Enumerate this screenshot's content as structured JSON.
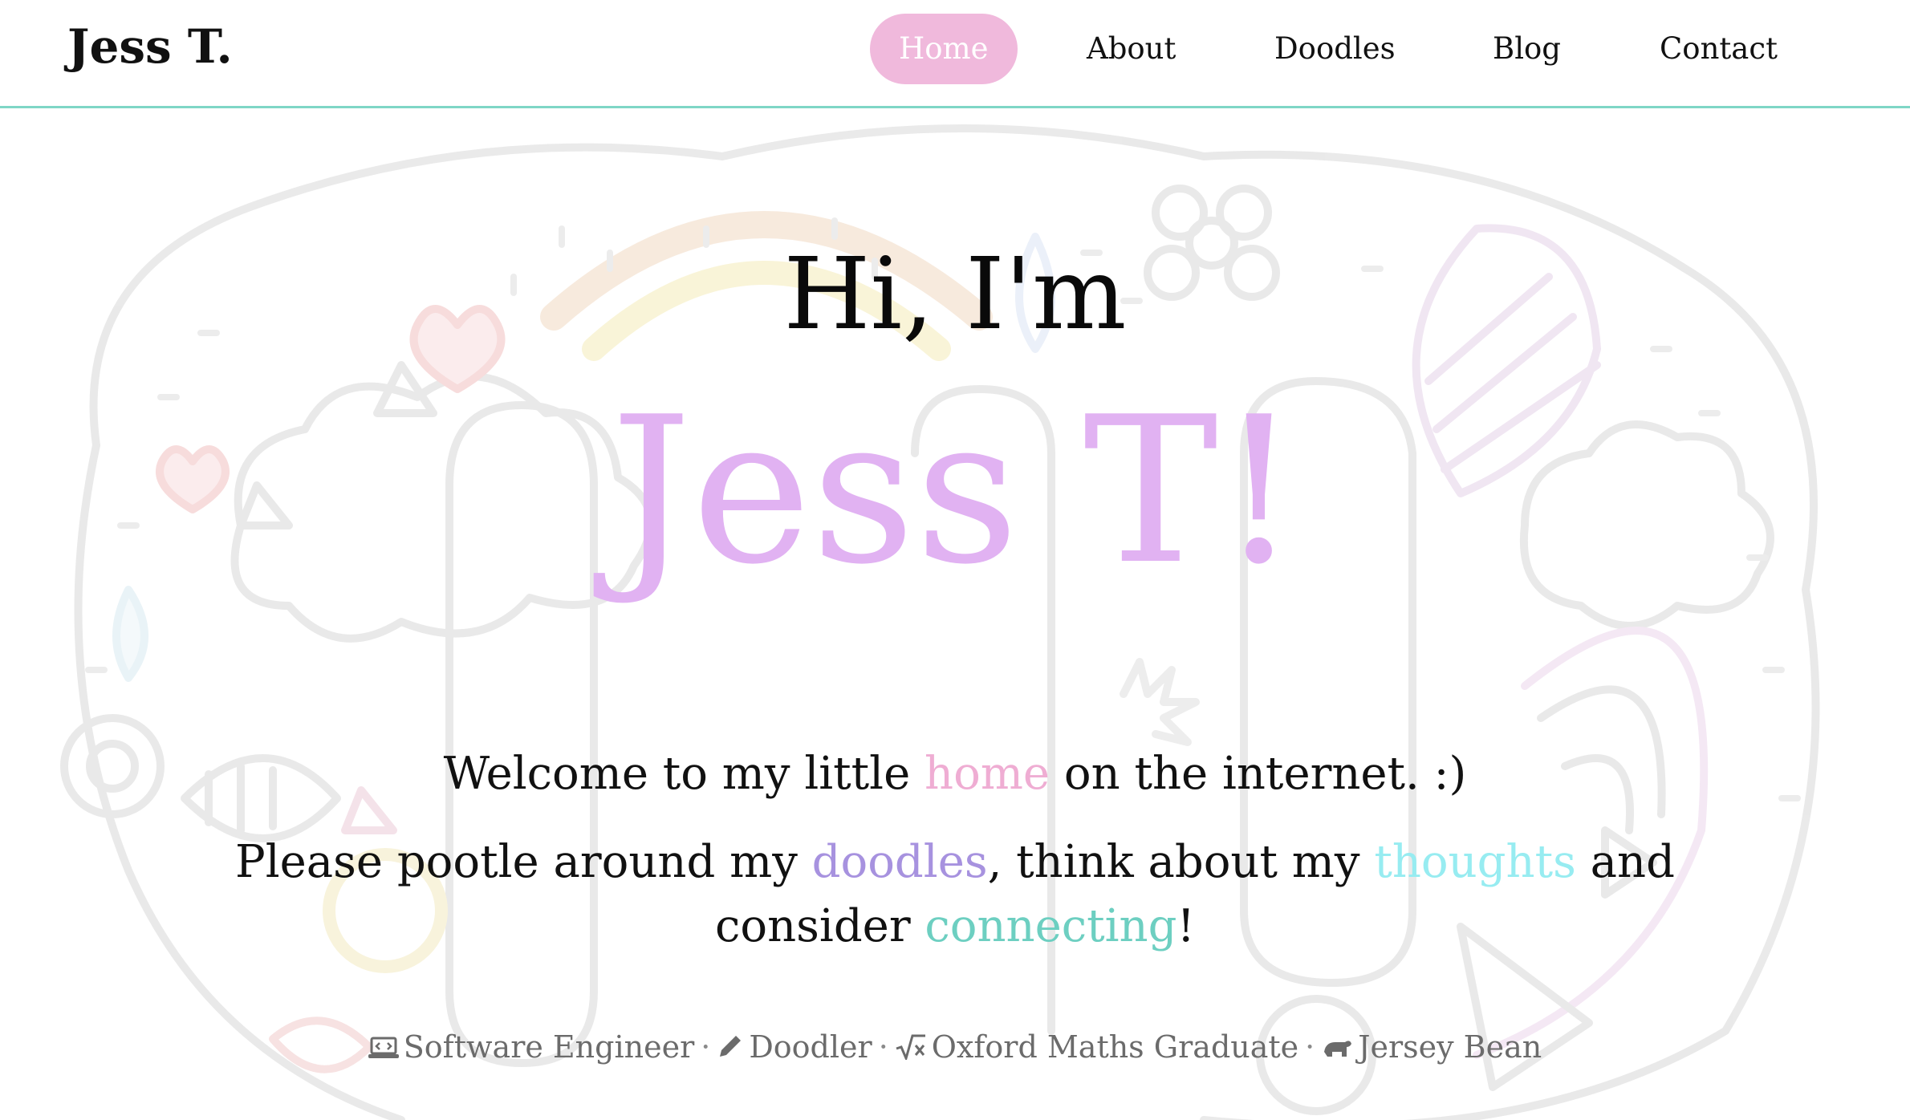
{
  "header": {
    "brand": "Jess T.",
    "nav": [
      {
        "label": "Home",
        "active": true
      },
      {
        "label": "About",
        "active": false
      },
      {
        "label": "Doodles",
        "active": false
      },
      {
        "label": "Blog",
        "active": false
      },
      {
        "label": "Contact",
        "active": false
      }
    ]
  },
  "hero": {
    "greeting": "Hi, I'm",
    "name": "Jess T!",
    "welcome": {
      "before": "Welcome to my little ",
      "highlight": "home",
      "after": " on the internet. :)"
    },
    "invite": {
      "part1": "Please pootle around my ",
      "doodles_link": "doodles",
      "part2": ", think about my ",
      "thoughts_link": "thoughts",
      "part3": " and consider ",
      "connecting_link": "connecting",
      "part4": "!"
    },
    "tags": [
      {
        "icon": "laptop-code-icon",
        "label": "Software Engineer"
      },
      {
        "icon": "pencil-icon",
        "label": "Doodler"
      },
      {
        "icon": "square-root-icon",
        "label": "Oxford Maths Graduate"
      },
      {
        "icon": "cow-icon",
        "label": "Jersey Bean"
      }
    ],
    "separator": "·"
  },
  "colors": {
    "accent_pink": "#f0b9dc",
    "name_lilac": "#e1b2f2",
    "doodles_purple": "#a792df",
    "thoughts_cyan": "#97ecf1",
    "connecting_teal": "#6dcfc1",
    "header_rule": "#7fd6c6"
  }
}
